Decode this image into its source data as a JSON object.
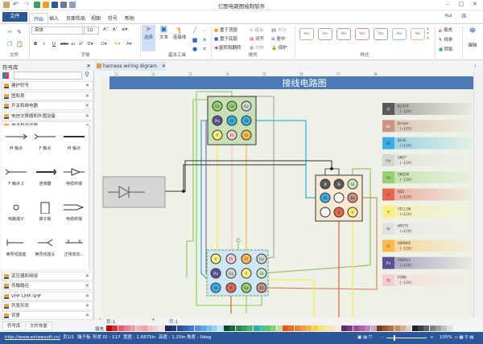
{
  "app": {
    "title": "亿图电路图绘制软件",
    "user": "Rui"
  },
  "menu": {
    "file": "文件",
    "tabs": [
      "开始",
      "插入",
      "页面布局",
      "视图",
      "符号",
      "帮助"
    ]
  },
  "ribbon": {
    "groups": {
      "file": "文件",
      "font": "字体",
      "tools": "基本工具",
      "arrange": "排列",
      "style": "样式"
    },
    "font_name": "宋体",
    "font_size": "10",
    "tools": {
      "select": "选择",
      "text": "文本",
      "connector": "连接线"
    },
    "arrange": {
      "front": "置于顶层",
      "back": "置于底层",
      "rotate": "旋转和翻转",
      "group": "组合",
      "align": "对齐",
      "distribute": "分布",
      "size": "大小",
      "center": "居中",
      "protect": "保护"
    },
    "style_sample": "Abc",
    "style_colors": [
      "#a9c089",
      "#a5a5a5",
      "#8faad1",
      "#d99694",
      "#a797c2",
      "#93c6d4",
      "#f0b88b"
    ],
    "fill": "填充",
    "line": "线条",
    "shadow": "阴影",
    "edit": "编辑"
  },
  "library": {
    "title": "符号库",
    "top_categories": [
      "建护符号",
      "图和表",
      "开关和继电器",
      "电信交换器和外围设备",
      "端子和连接器"
    ],
    "symbols": [
      "M 触点",
      "F 触点",
      "M 触点",
      "F 触点 2",
      "连接器",
      "电缆终端",
      "电路端子",
      "端子板",
      "电缆终端",
      "两导线插座",
      "两导线插头",
      "正常双向..."
    ],
    "bottom_categories": [
      "变压器和绕组",
      "传输路径",
      "VHF-UHF-SHF",
      "列表形状",
      "背景"
    ],
    "tabs": [
      "符号库",
      "文件恢复"
    ]
  },
  "document": {
    "tab": "harness wiring digram",
    "heading": "接线电路图",
    "ruler": [
      "1",
      "2",
      "3",
      "4",
      "5",
      "6",
      "7",
      "8"
    ]
  },
  "connectors": {
    "top": [
      "Gr",
      "Gr",
      "Gy",
      "Pu",
      "Bl",
      "Bl",
      "Y",
      "Pi",
      "O"
    ],
    "right": [
      "B",
      "B",
      "Gl",
      "Bl",
      "",
      "Br",
      "",
      "R",
      "Y"
    ],
    "bottom": [
      "Y",
      "Pi",
      "O",
      "Gy",
      "Pu",
      "Gy",
      "Y",
      "Gl",
      "Bl",
      "R",
      "Gr",
      "Br"
    ]
  },
  "legend": [
    {
      "code": "B",
      "name": "BLACK",
      "volt": "(-12V)",
      "color": "#5a5a5a"
    },
    {
      "code": "Br",
      "name": "Brown",
      "volt": "(+12V)",
      "color": "#c99481"
    },
    {
      "code": "Bl",
      "name": "BLUE",
      "volt": "(+12V)",
      "color": "#3aaee6"
    },
    {
      "code": "Gy",
      "name": "GREY",
      "volt": "(-12V)",
      "color": "#d3d7d3"
    },
    {
      "code": "Gr",
      "name": "GREEN",
      "volt": "(-12V)",
      "color": "#96d06f"
    },
    {
      "code": "R",
      "name": "RED",
      "volt": "(+12V)",
      "color": "#e8654f"
    },
    {
      "code": "Y",
      "name": "YELLOW",
      "volt": "(+12V)",
      "color": "#fbf07a"
    },
    {
      "code": "W",
      "name": "WHITE",
      "volt": "(+12V)",
      "color": "#e2e2e4"
    },
    {
      "code": "O",
      "name": "ORANGE",
      "volt": "(-12V)",
      "color": "#fdb94c"
    },
    {
      "code": "Pu",
      "name": "PURPLE",
      "volt": "(+12V)",
      "color": "#5c5094"
    },
    {
      "code": "Pi",
      "name": "PINK",
      "volt": "(-12V)",
      "color": "#f8cdd0"
    }
  ],
  "pages": {
    "current": "页-1",
    "tab": "页-1",
    "add": "+"
  },
  "palette": {
    "label": "填充",
    "colors": [
      "#c00000",
      "#e03030",
      "#e85a6a",
      "#ee7c8c",
      "#f09aa8",
      "#f4b4bc",
      "#f2a0a0",
      "#f6c0c0",
      "#f8d0d8",
      "#fbe0e8",
      "#1f2a5a",
      "#263a7a",
      "#2d4f9a",
      "#3566b4",
      "#3d7ccc",
      "#4a94de",
      "#5aaae8",
      "#70c0f0",
      "#96d2f4",
      "#c0e4f8",
      "#0a4a2a",
      "#1a6a3a",
      "#2a8a4a",
      "#3aa05a",
      "#4ab46a",
      "#2ab0a0",
      "#40c0b0",
      "#60c870",
      "#90d070",
      "#c0e090",
      "#f05010",
      "#f46a20",
      "#f88030",
      "#fa9a40",
      "#fcb440",
      "#fdd040",
      "#fde070",
      "#fce8a0",
      "#fae0c0",
      "#f8ecd8",
      "#5a2a6a",
      "#7a3a8a",
      "#9a4aa0",
      "#b060b0",
      "#c080c0",
      "#d0a0d0",
      "#7a3a1a",
      "#9a5a2a",
      "#b07040",
      "#c89060",
      "#d8b090",
      "#e0d0c0",
      "#202020",
      "#404040",
      "#606060",
      "#808080",
      "#a0a0a0",
      "#c0c0c0",
      "#e0e0e0"
    ]
  },
  "status": {
    "url": "http://www.edrawsoft.cn/",
    "page": "页1/1",
    "shape": "端子板",
    "shape_id": "形状 ID : 117",
    "width": "宽度 : 1.6875in",
    "height": "高度 : 1.25in",
    "angle": "角度 : 0deg",
    "zoom": "105%"
  }
}
